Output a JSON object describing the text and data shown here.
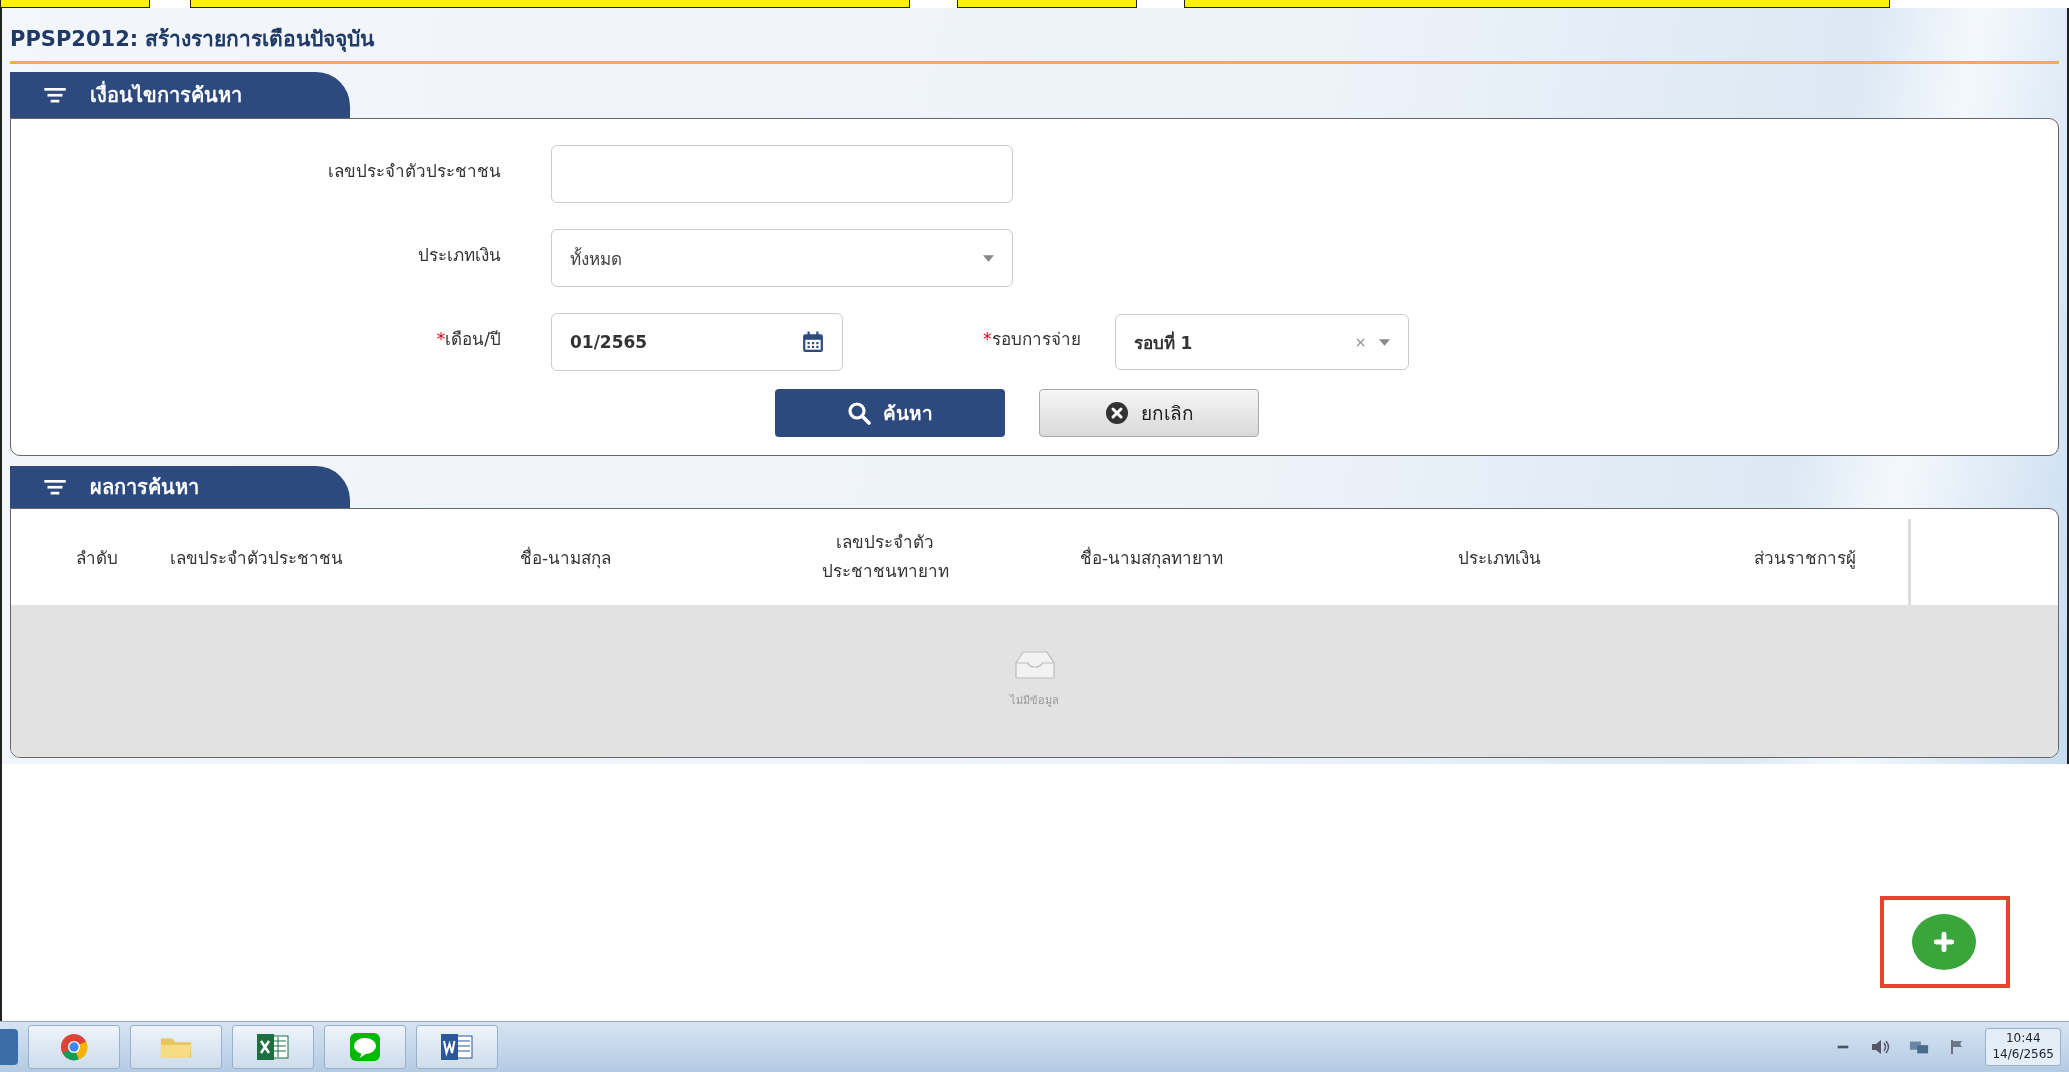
{
  "page": {
    "title": "PPSP2012: สร้างรายการเตือนปัจจุบัน"
  },
  "search_panel": {
    "heading": "เงื่อนไขการค้นหา",
    "rows": [
      [
        {
          "kind": "text",
          "label": "เลขประจำตัวประชาชน"
        }
      ],
      [
        {
          "kind": "select",
          "label": "ประเภทเงิน",
          "value": "ทั้งหมด"
        }
      ],
      [
        {
          "kind": "date",
          "label": "เดือน/ปี",
          "required_mark": "*",
          "value": "01/2565"
        },
        {
          "kind": "select",
          "label": "รอบการจ่าย",
          "required_mark": "*",
          "value": "รอบที่ 1",
          "clear": "×"
        }
      ]
    ],
    "buttons": [
      {
        "kind": "search",
        "label": "ค้นหา"
      },
      {
        "kind": "cancel",
        "label": "ยกเลิก"
      }
    ]
  },
  "results": {
    "heading": "ผลการค้นหา",
    "columns": [
      "ลำดับ",
      "เลขประจำตัวประชาชน",
      "ชื่อ-นามสกุล",
      "เลขประจำตัว ประชาชนทายาท",
      "ชื่อ-นามสกุลทายาท",
      "ประเภทเงิน",
      "ส่วนราชการผู้"
    ],
    "empty_text": "ไม่มีข้อมูล"
  },
  "add_button": {
    "highlighted": true
  },
  "taskbar": {
    "apps": [
      {
        "kind": "chrome"
      },
      {
        "kind": "folder"
      },
      {
        "kind": "excel"
      },
      {
        "kind": "line"
      },
      {
        "kind": "word"
      }
    ],
    "clock": {
      "time": "10:44",
      "date": "14/6/2565"
    }
  }
}
